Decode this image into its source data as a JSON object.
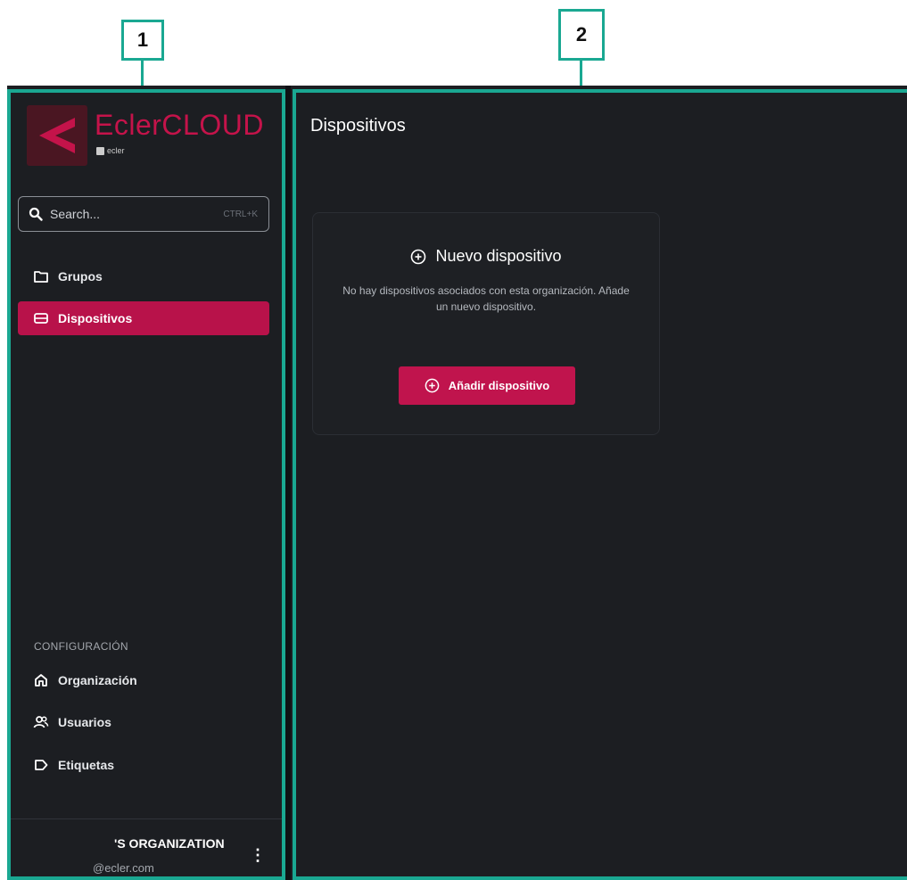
{
  "callouts": {
    "sidebar_number": "1",
    "main_number": "2"
  },
  "colors": {
    "highlight": "#1aa892",
    "accent": "#c0144d",
    "background": "#1c1e22"
  },
  "brand": {
    "name": "EclerCLOUD",
    "sub_label": "ecler"
  },
  "search": {
    "placeholder": "Search...",
    "shortcut": "CTRL+K",
    "icon": "search-icon"
  },
  "sidebar": {
    "items": [
      {
        "label": "Grupos",
        "icon": "folder-icon",
        "active": false
      },
      {
        "label": "Dispositivos",
        "icon": "device-icon",
        "active": true
      }
    ],
    "settings_heading": "CONFIGURACIÓN",
    "settings_items": [
      {
        "label": "Organización",
        "icon": "home-icon"
      },
      {
        "label": "Usuarios",
        "icon": "users-icon"
      },
      {
        "label": "Etiquetas",
        "icon": "tag-icon"
      }
    ],
    "organization": {
      "name": "'S ORGANIZATION",
      "email": "@ecler.com",
      "menu_icon": "more-vertical-icon"
    }
  },
  "main": {
    "title": "Dispositivos",
    "empty_state": {
      "title": "Nuevo dispositivo",
      "description": "No hay dispositivos asociados con esta organización. Añade un nuevo dispositivo.",
      "button_label": "Añadir dispositivo",
      "title_icon": "plus-circle-icon",
      "button_icon": "plus-circle-icon"
    }
  }
}
